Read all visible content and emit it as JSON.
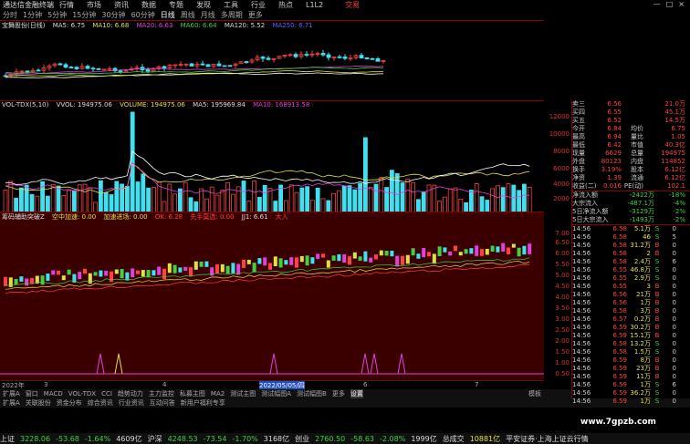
{
  "menubar": {
    "app": "通达信金融终端",
    "items": [
      "行情",
      "市场",
      "资讯",
      "数据",
      "专题",
      "发现",
      "工具",
      "行业",
      "热点",
      "L1L2"
    ],
    "trade": "交易",
    "window_controls": [
      "—",
      "□",
      "×"
    ]
  },
  "periods": {
    "items": [
      "分时",
      "1分钟",
      "5分钟",
      "15分钟",
      "30分钟",
      "60分钟",
      "日线",
      "周线",
      "月线",
      "多周期",
      "更多"
    ],
    "selected": "日线"
  },
  "kline": {
    "title": "宝舞股份(日线)",
    "ma5": "MA5: 6.75",
    "ma10": "MA10: 6.68",
    "ma20": "MA20: 6.63",
    "ma60": "MA60: 6.64",
    "ma120": "MA120: 5.52",
    "ma250": "MA250: 6.71"
  },
  "volume": {
    "title": "VOL-TDX(5,10)",
    "vvol": "VVOL: 194975.06",
    "volume": "VOLUME: 194975.06",
    "ma5": "MA5: 195969.84",
    "ma10": "MA10: 168913.58",
    "axis": [
      "12000",
      "10000",
      "8000",
      "6000",
      "4000",
      "2000"
    ]
  },
  "indicator": {
    "title": "筹码辅助突破Z",
    "items": [
      "空中加速: 0.00",
      "加速进场: 0.00",
      "OK: 6.28",
      "先手莫选: 0.00",
      "JJ1: 6.61",
      "大入"
    ],
    "axis": [
      "7.00",
      "6.50",
      "6.00",
      "5.50",
      "5.00",
      "4.50",
      "4.00",
      "3.50",
      "3.00",
      "2.50",
      "2.00",
      "1.50",
      "1.00",
      "0.50"
    ]
  },
  "datebar": {
    "labels": [
      "2022年",
      "3",
      "4",
      "2022/05/05/四",
      "6",
      "7"
    ]
  },
  "tabs": {
    "items": [
      "扩展A",
      "窗口",
      "MACD",
      "VOL-TDX",
      "CCI",
      "趋势动力",
      "主力监控",
      "私募主图",
      "MA2",
      "测试主图",
      "测试幅图A",
      "测试幅图B",
      "更多",
      "设置"
    ],
    "selected": "设置",
    "mode": "模板"
  },
  "subtabs": {
    "items": [
      "扩展A",
      "关联股份",
      "资金分布",
      "综合资讯",
      "行业资讯",
      "互动问答",
      "新用户福利专享"
    ]
  },
  "quote": {
    "rows": [
      [
        "卖三",
        "6.56",
        "",
        "21.0万"
      ],
      [
        "买四",
        "6.55",
        "",
        "45.1万"
      ],
      [
        "买五",
        "6.52",
        "",
        "14.5万"
      ],
      [
        "今开",
        "6.84",
        "均价",
        "6.75"
      ],
      [
        "最高",
        "6.94",
        "量比",
        "1.05"
      ],
      [
        "最低",
        "6.42",
        "市值",
        "40.3亿"
      ],
      [
        "现量",
        "6629",
        "总量",
        "194975"
      ],
      [
        "外盘",
        "80123",
        "内盘",
        "114852"
      ],
      [
        "换手",
        "3.19%",
        "股本",
        "6.12亿"
      ],
      [
        "净资",
        "1.39",
        "流通",
        "6.12亿"
      ],
      [
        "收益(二)",
        "0.016",
        "PE(动)",
        "102.1"
      ]
    ]
  },
  "flow": {
    "rows": [
      [
        "净流入额",
        "-2422万",
        "-18%"
      ],
      [
        "大宗流入",
        "-487.1万",
        "-4%"
      ],
      [
        "5日净流入额",
        "-3129万",
        "-2%"
      ],
      [
        "5日大宗流入",
        "-1493万",
        "-2%"
      ]
    ]
  },
  "ticks": [
    [
      "14:56",
      "6.58",
      "5.1万",
      "S",
      "0"
    ],
    [
      "14:56",
      "6.58",
      "46",
      "S",
      "5"
    ],
    [
      "14:56",
      "6.58",
      "31.2万",
      "B",
      "0"
    ],
    [
      "14:56",
      "6.58",
      "2",
      "B",
      "0"
    ],
    [
      "14:56",
      "6.58",
      "2.4万",
      "S",
      "6"
    ],
    [
      "14:56",
      "6.55",
      "46.8万",
      "S",
      "0"
    ],
    [
      "14:56",
      "6.55",
      "2.9万",
      "S",
      "0"
    ],
    [
      "14:56",
      "6.55",
      "3",
      "B",
      "0"
    ],
    [
      "14:56",
      "6.56",
      "21万",
      "B",
      "0"
    ],
    [
      "14:56",
      "6.56",
      "1万",
      "B",
      "0"
    ],
    [
      "14:56",
      "6.58",
      "3万",
      "B",
      "0"
    ],
    [
      "14:56",
      "6.57",
      "0.2万",
      "B",
      "0"
    ],
    [
      "14:56",
      "6.59",
      "30.2万",
      "B",
      "0"
    ],
    [
      "14:56",
      "6.59",
      "15.1万",
      "B",
      "0"
    ],
    [
      "14:56",
      "6.58",
      "13.2万",
      "S",
      "0"
    ],
    [
      "14:56",
      "6.58",
      "1.5万",
      "S",
      "0"
    ],
    [
      "14:56",
      "6.59",
      "8万",
      "B",
      "0"
    ],
    [
      "14:56",
      "6.59",
      "23万",
      "B",
      "0"
    ],
    [
      "14:56",
      "6.59",
      "11万",
      "B",
      "0"
    ],
    [
      "14:56",
      "6.59",
      "1万",
      "S",
      "6"
    ],
    [
      "14:56",
      "6.59",
      "36.2万",
      "S",
      "0"
    ],
    [
      "14:56",
      "6.59",
      "1万",
      "S",
      "0"
    ]
  ],
  "statusbar": [
    {
      "label": "上证",
      "value": "3228.06",
      "chg": "-53.68",
      "pct": "-1.64%",
      "amt": "4609亿"
    },
    {
      "label": "沪深",
      "value": "4248.53",
      "chg": "-73.54",
      "pct": "-1.70%",
      "amt": "3168亿"
    },
    {
      "label": "创业",
      "value": "2760.50",
      "chg": "-58.63",
      "pct": "-2.08%",
      "amt": "1999亿"
    }
  ],
  "status_extra": {
    "deal": "总成交",
    "deal_val": "10881亿",
    "news": "平安证券·上海上证云行情"
  },
  "watermark": "www.7gpzb.com",
  "colors": {
    "up": "#ff4040",
    "down": "#40d040",
    "cyan": "#40e0f0",
    "yellow": "#e0e040",
    "magenta": "#e040e0",
    "grid": "#800000"
  }
}
